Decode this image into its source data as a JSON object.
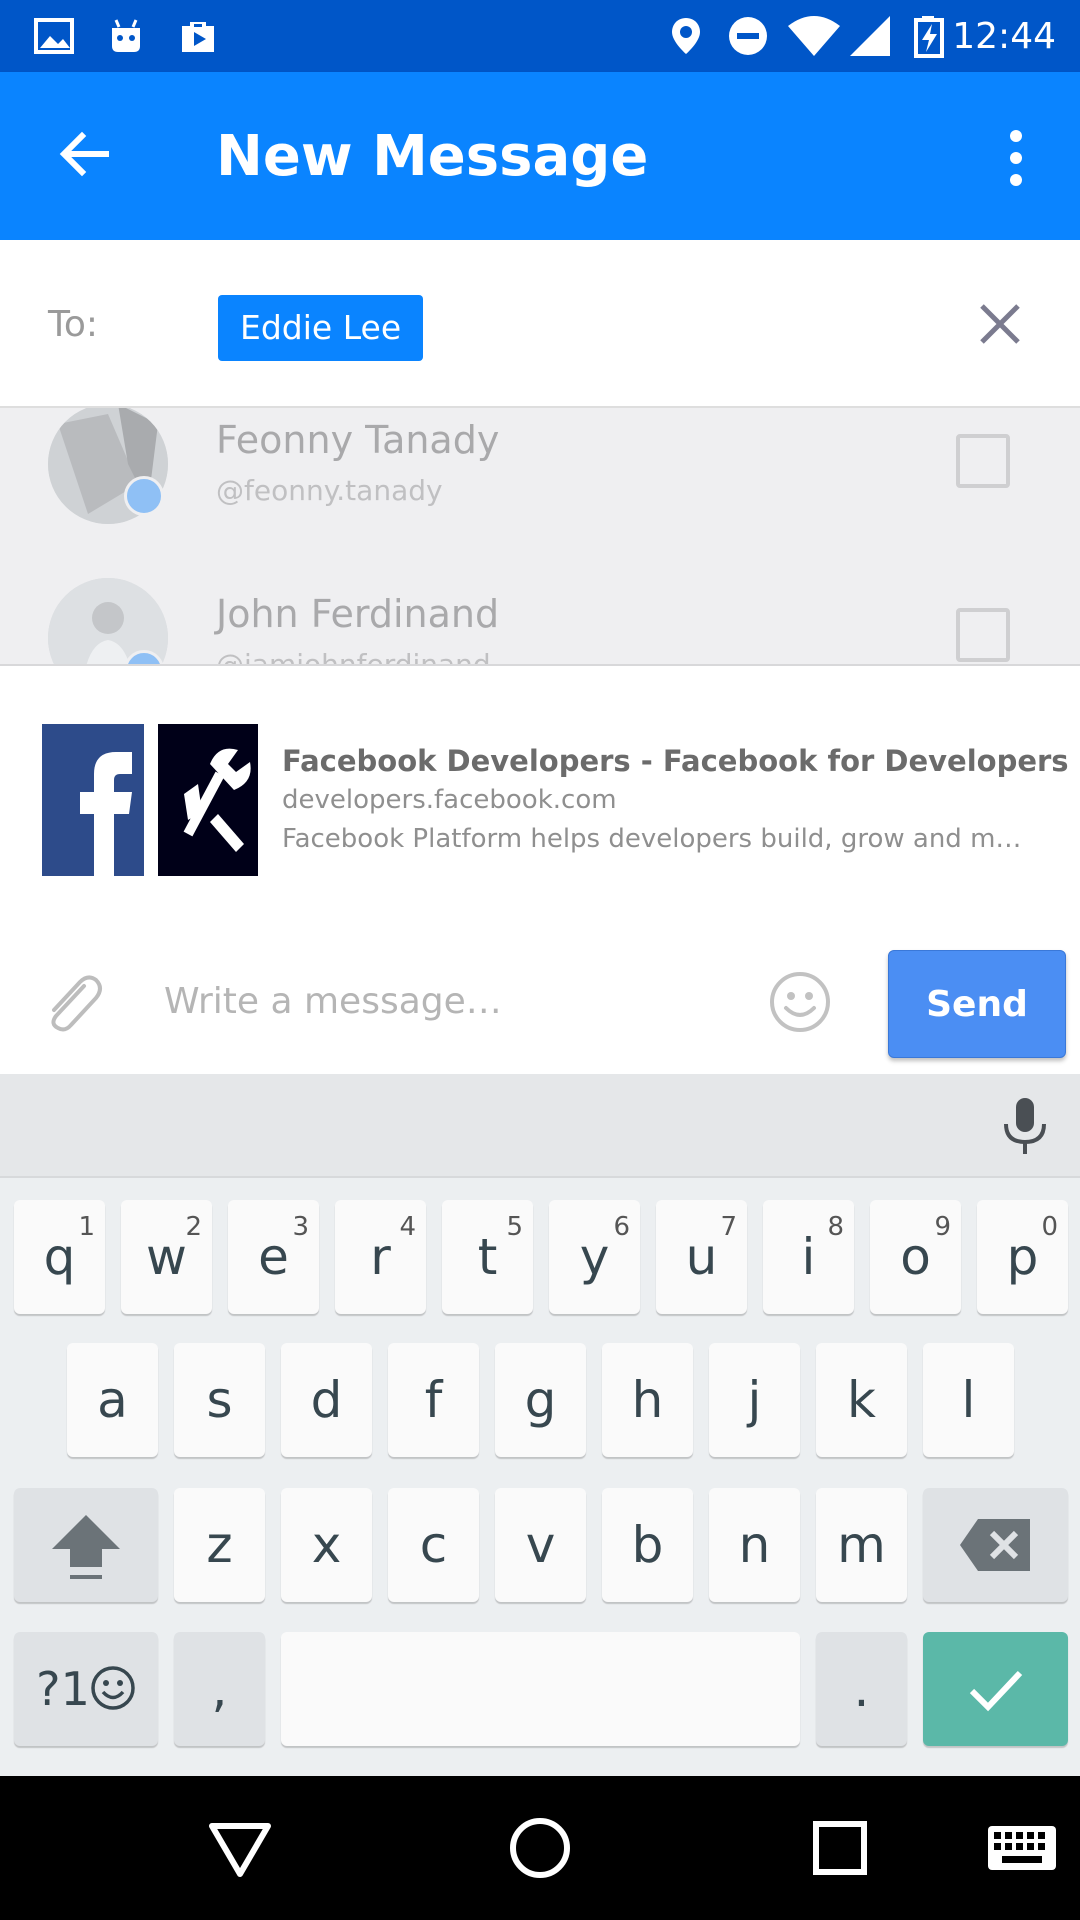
{
  "status_bar": {
    "time": "12:44",
    "left_icons": [
      "image-icon",
      "android-icon",
      "play-store-icon"
    ],
    "right_icons": [
      "location-icon",
      "do-not-disturb-icon",
      "wifi-icon",
      "signal-icon",
      "battery-charging-icon"
    ]
  },
  "app_bar": {
    "title": "New Message",
    "back_icon": "arrow-left-icon",
    "menu_icon": "more-vert-icon",
    "background": "#0a84ff"
  },
  "recipients": {
    "label": "To:",
    "chips": [
      "Eddie Lee"
    ],
    "clear_icon": "close-icon"
  },
  "contacts": [
    {
      "name": "Feonny Tanady",
      "handle": "@feonny.tanady",
      "checked": false
    },
    {
      "name": "John Ferdinand",
      "handle": "@iamjohnferdinand",
      "checked": false
    }
  ],
  "link_preview": {
    "title": "Facebook Developers - Facebook for Developers",
    "domain": "developers.facebook.com",
    "description": "Facebook Platform helps developers build, grow and mo…"
  },
  "composer": {
    "placeholder": "Write a message…",
    "send_label": "Send",
    "attach_icon": "paperclip-icon",
    "emoji_icon": "smiley-icon"
  },
  "keyboard": {
    "row1": [
      {
        "k": "q",
        "h": "1"
      },
      {
        "k": "w",
        "h": "2"
      },
      {
        "k": "e",
        "h": "3"
      },
      {
        "k": "r",
        "h": "4"
      },
      {
        "k": "t",
        "h": "5"
      },
      {
        "k": "y",
        "h": "6"
      },
      {
        "k": "u",
        "h": "7"
      },
      {
        "k": "i",
        "h": "8"
      },
      {
        "k": "o",
        "h": "9"
      },
      {
        "k": "p",
        "h": "0"
      }
    ],
    "row2": [
      "a",
      "s",
      "d",
      "f",
      "g",
      "h",
      "j",
      "k",
      "l"
    ],
    "row3": [
      "z",
      "x",
      "c",
      "v",
      "b",
      "n",
      "m"
    ],
    "symbols_label": "?1",
    "comma": ",",
    "period": ".",
    "accent": "#5bb8a8"
  },
  "nav_bar": {
    "icons": [
      "back-triangle-icon",
      "home-circle-icon",
      "recents-square-icon",
      "keyboard-icon"
    ]
  }
}
